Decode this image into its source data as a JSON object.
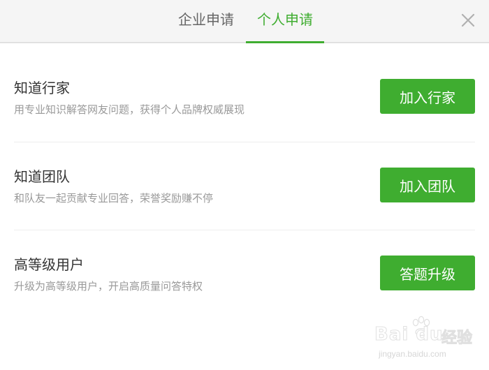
{
  "tabs": [
    {
      "label": "企业申请",
      "active": false
    },
    {
      "label": "个人申请",
      "active": true
    }
  ],
  "close_icon": "close-icon",
  "rows": [
    {
      "title": "知道行家",
      "description": "用专业知识解答网友问题，获得个人品牌权威展现",
      "button": "加入行家"
    },
    {
      "title": "知道团队",
      "description": "和队友一起贡献专业回答，荣誉奖励赚不停",
      "button": "加入团队"
    },
    {
      "title": "高等级用户",
      "description": "升级为高等级用户，开启高质量问答特权",
      "button": "答题升级"
    }
  ],
  "watermark": {
    "logo": "Bai du",
    "logo_suffix": "经验",
    "url": "jingyan.baidu.com"
  },
  "colors": {
    "accent": "#3fad30",
    "header_bg": "#f5f5f5",
    "title": "#333333",
    "description": "#999999",
    "tab_inactive": "#666666"
  }
}
